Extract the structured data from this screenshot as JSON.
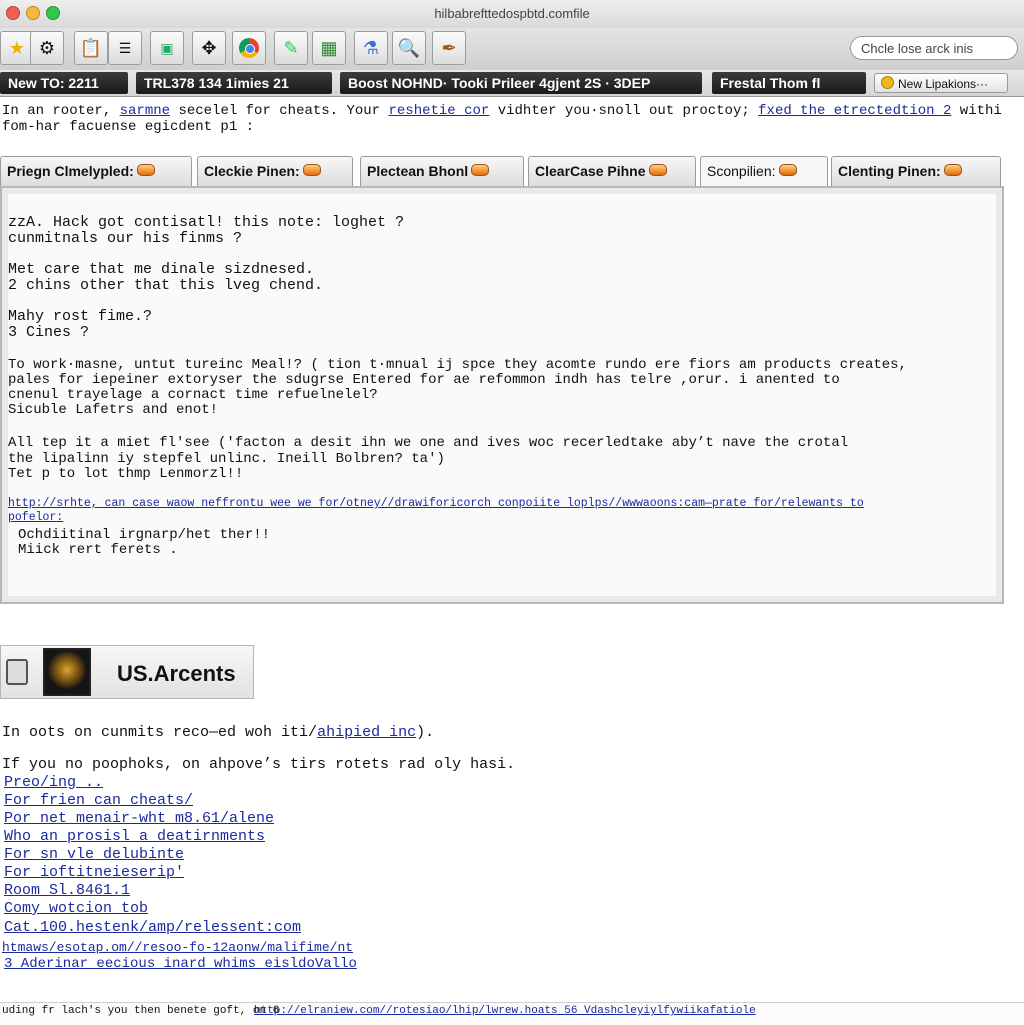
{
  "window": {
    "title": "hilbabrefttedospbtd.comfile"
  },
  "toolbar": {
    "icons": [
      "star-icon",
      "gear-icon",
      "clipboard-icon",
      "document-icon",
      "monitor-icon",
      "arrows-icon",
      "chrome-icon",
      "edit-icon",
      "grid-icon",
      "flask-icon",
      "search-icon",
      "pen-icon"
    ],
    "search_placeholder": "Chcle lose arck inis"
  },
  "tabs": [
    "New TO: 2211",
    "TRL378 134 1imies 21",
    "Boost NOHND· Tooki Prileer 4gjent 2S · 3DEP",
    "Frestal Thom fl"
  ],
  "new_tab_label": "New Lipakions···",
  "intro": {
    "line1_a": "In an rooter, ",
    "line1_b": "sarmne",
    "line1_c": " secelel for cheats. Your ",
    "line1_link1": "reshetie cor",
    "line1_d": " vidhter you·snoll out proctoy; ",
    "line1_link2": "fxed the etrectedtion 2",
    "line1_e": " withi",
    "line2": "fom-har facuense egicdent p1 :"
  },
  "subtabs": [
    "Priegn Clmelypled:",
    "Cleckie Pinen:",
    "Plectean Bhonl",
    "ClearCase Pihne",
    "Sconpilien:",
    "Clenting Pinen:"
  ],
  "content": {
    "p1": [
      "zzA. Hack got contisatl! this note: loghet ?",
      "cunmitnals our his finms ?"
    ],
    "p2": [
      "Met care that me dinale sizdnesed.",
      "2 chins other that this lveg chend."
    ],
    "p3": [
      "Mahy rost fime.?",
      "3 Cines ?"
    ],
    "p4": [
      "To work·masne, untut tureinc Meal!? ( tion t·mnual ij spce they acomte rundo ere fiors am products creates,",
      "pales for iepeiner extoryser the sdugrse Entered for ae refommon indh has telre ,orur. i anented to",
      "cnenul trayelage a cornact time refuelnelel?",
      "Sicuble Lafetrs and enot!"
    ],
    "p5": [
      "All tep it a miet fl'see ('facton a desit ihn we one and ives woc recerledtake aby’t nave the crotal",
      "the lipalinn iy stepfel unlinc. Ineill Bolbren? ta')",
      "Tet p to lot thmp Lenmorzl!!"
    ],
    "url_line": "http://srhte, can case waow neffrontu wee we for/otney//drawiforicorch conpoiite loplps//wwwaoons:cam—prate for/relewants to",
    "url_cont": "pofelor:",
    "p6": [
      "Ochdiitinal irgnarp/het ther!!",
      "Miick rert ferets ."
    ]
  },
  "section": {
    "title": "US.Arcents"
  },
  "after": {
    "line1_a": "In oots on cunmits reco—ed woh iti/",
    "line1_link": "ahipied inc",
    "line1_b": ").",
    "line2": "If you no poophoks, on ahpove’s tirs rotets rad oly hasi."
  },
  "links": [
    "Preo/ing ..",
    "For frien can cheats/",
    "Por net menair-wht m8.61/alene",
    "Who an prosisl a deatirnments",
    "For sn vle delubinte",
    "For ioftitneieserip'",
    "Room Sl.8461.1",
    "Comy wotcion tob",
    "Cat.100.hestenk/amp/relessent:com",
    "htmaws/esotap.om//resoo-fo-12aonw/malifime/nt",
    "3 Aderinar eecious inard whims eisldoVallo"
  ],
  "status": {
    "text": "uding fr lach's you then benete goft, on 6",
    "link": "http://elraniew.com//rotesiao/lhip/lwrew.hoats 56 Vdashcleyiylfywiikafatiole"
  },
  "colors": {
    "link": "#1a2aa0",
    "tab_dark": "#1f1f1f",
    "accent_orange": "#e06a10"
  }
}
